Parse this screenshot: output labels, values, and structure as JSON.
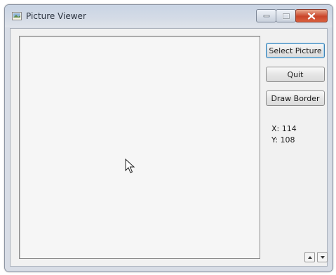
{
  "window": {
    "title": "Picture Viewer",
    "icon": "app-icon",
    "controls": [
      "minimize-icon",
      "maximize-icon",
      "close-icon"
    ]
  },
  "buttons": {
    "select_picture": "Select Picture",
    "quit": "Quit",
    "draw_border": "Draw Border"
  },
  "coordinates": {
    "x_label": "X: 114",
    "y_label": "Y: 108"
  },
  "colors": {
    "titlebar": "#d4dbe6",
    "close_button": "#c9452a",
    "client_background": "#f1f1f1",
    "focused_border": "#3c7fb1"
  }
}
